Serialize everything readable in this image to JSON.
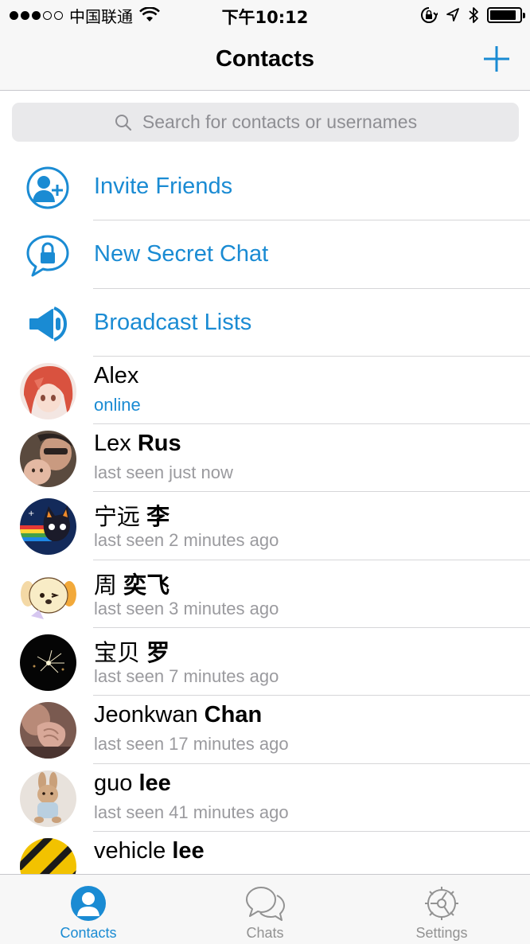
{
  "status_bar": {
    "carrier": "中国联通",
    "time": "下午10:12",
    "signal_dots_filled": 3,
    "signal_dots_total": 5,
    "battery_level": 0.9,
    "icons": [
      "wifi-icon",
      "orientation-lock-icon",
      "location-icon",
      "bluetooth-icon",
      "battery-icon"
    ]
  },
  "nav": {
    "title": "Contacts",
    "add_icon": "plus-icon"
  },
  "search": {
    "placeholder": "Search for contacts or usernames",
    "icon": "search-icon"
  },
  "actions": [
    {
      "label": "Invite Friends",
      "icon": "add-person-icon"
    },
    {
      "label": "New Secret Chat",
      "icon": "lock-bubble-icon"
    },
    {
      "label": "Broadcast Lists",
      "icon": "megaphone-icon"
    }
  ],
  "contacts": [
    {
      "first": "Alex",
      "last": "",
      "status": "online",
      "online": true,
      "avatar": "anime-girl-avatar"
    },
    {
      "first": "Lex",
      "last": "Rus",
      "status": "last seen just now",
      "online": false,
      "avatar": "family-photo-avatar"
    },
    {
      "first": "宁远",
      "last": "李",
      "status": "last seen 2 minutes ago",
      "online": false,
      "avatar": "cartoon-cat-avatar"
    },
    {
      "first": "周",
      "last": "奕飞",
      "status": "last seen 3 minutes ago",
      "online": false,
      "avatar": "cartoon-dog-avatar"
    },
    {
      "first": "宝贝",
      "last": "罗",
      "status": "last seen 7 minutes ago",
      "online": false,
      "avatar": "fireworks-avatar"
    },
    {
      "first": "Jeonkwan",
      "last": "Chan",
      "status": "last seen 17 minutes ago",
      "online": false,
      "avatar": "hands-photo-avatar"
    },
    {
      "first": "guo",
      "last": "lee",
      "status": "last seen 41 minutes ago",
      "online": false,
      "avatar": "plush-bunny-avatar"
    },
    {
      "first": "vehicle",
      "last": "lee",
      "status": "",
      "online": false,
      "avatar": "hazard-stripes-avatar"
    }
  ],
  "tabs": [
    {
      "label": "Contacts",
      "icon": "contacts-icon",
      "active": true
    },
    {
      "label": "Chats",
      "icon": "chats-icon",
      "active": false
    },
    {
      "label": "Settings",
      "icon": "settings-gear-icon",
      "active": false
    }
  ],
  "colors": {
    "accent": "#1a8bd3",
    "secondary_text": "#9a9a9e",
    "bar_background": "#f7f7f7"
  }
}
